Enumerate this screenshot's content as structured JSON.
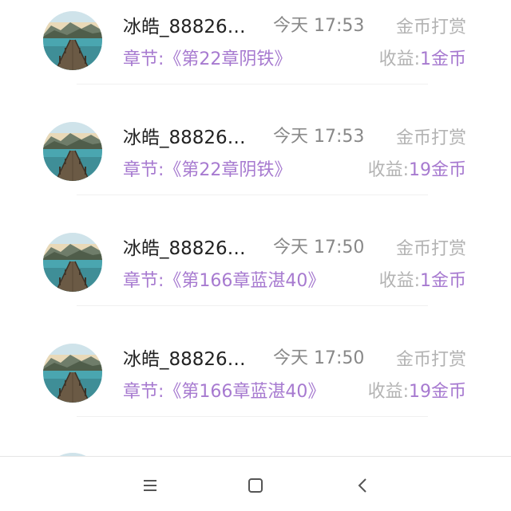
{
  "items": [
    {
      "name": "冰皓_88826…",
      "time": "今天 17:53",
      "type": "金币打赏",
      "chapter": "章节:《第22章阴铁》",
      "income_label": "收益:",
      "income_value": "1金币"
    },
    {
      "name": "冰皓_88826…",
      "time": "今天 17:53",
      "type": "金币打赏",
      "chapter": "章节:《第22章阴铁》",
      "income_label": "收益:",
      "income_value": "19金币"
    },
    {
      "name": "冰皓_88826…",
      "time": "今天 17:50",
      "type": "金币打赏",
      "chapter": "章节:《第166章蓝湛40》",
      "income_label": "收益:",
      "income_value": "1金币"
    },
    {
      "name": "冰皓_88826…",
      "time": "今天 17:50",
      "type": "金币打赏",
      "chapter": "章节:《第166章蓝湛40》",
      "income_label": "收益:",
      "income_value": "19金币"
    }
  ],
  "navbar": {
    "icons": [
      "menu-icon",
      "home-square-icon",
      "back-chevron-icon"
    ]
  },
  "colors": {
    "accent": "#a77ad0",
    "text_primary": "#222222",
    "text_secondary": "#888888",
    "text_muted": "#b3b3b3"
  }
}
